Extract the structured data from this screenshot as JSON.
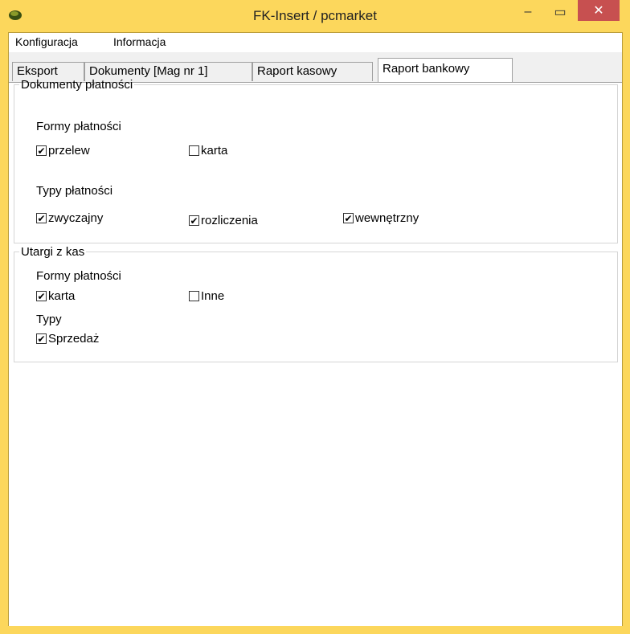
{
  "window": {
    "title": "FK-Insert  / pcmarket",
    "close_glyph": "✕",
    "minimize_glyph": "‒",
    "maximize_glyph": "▭"
  },
  "menu": [
    "Konfiguracja",
    "Informacja"
  ],
  "tabs": [
    "Eksport",
    "Dokumenty [Mag nr 1]",
    "Raport kasowy",
    "Raport bankowy"
  ],
  "active_tab": "Raport bankowy",
  "group1": {
    "legend": "Dokumenty płatności",
    "formy_label": "Formy płatności",
    "formy": [
      {
        "label": "przelew",
        "checked": true
      },
      {
        "label": "karta",
        "checked": false
      }
    ],
    "typy_label": "Typy płatności",
    "typy": [
      {
        "label": "zwyczajny",
        "checked": true
      },
      {
        "label": "rozliczenia",
        "checked": true
      },
      {
        "label": "wewnętrzny",
        "checked": true
      }
    ]
  },
  "group2": {
    "legend": "Utargi z kas",
    "formy_label": "Formy płatności",
    "formy": [
      {
        "label": "karta",
        "checked": true
      },
      {
        "label": "Inne",
        "checked": false
      }
    ],
    "typy_label": "Typy",
    "typy": [
      {
        "label": "Sprzedaż",
        "checked": true
      }
    ]
  },
  "check_glyph": "✔",
  "colors": {
    "frame": "#fcd75c",
    "close": "#c75050"
  }
}
